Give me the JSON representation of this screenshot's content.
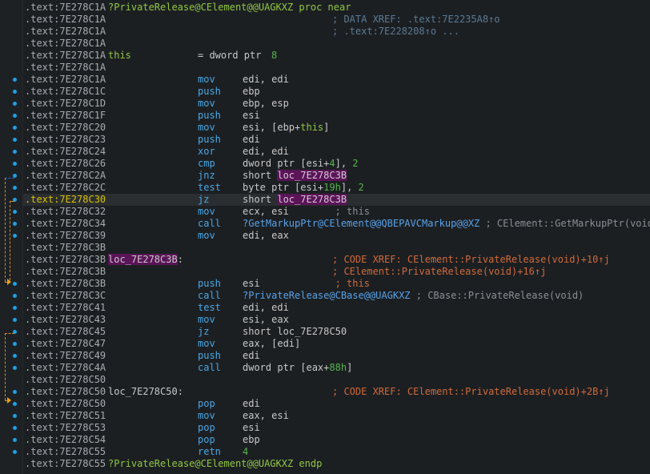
{
  "colors": {
    "background": "#1c1f22",
    "address": "#a8acb0",
    "highlight_address": "#d9c300",
    "mnemonic": "#4aa7e6",
    "comment": "#5a7a94",
    "label_bg": "#5a1457",
    "jump_arrow": "#d98b1d"
  },
  "rows": [
    {
      "addr": ".text:7E278C1A",
      "parts": [
        {
          "col": "label",
          "cls": "kw",
          "text": "?PrivateRelease@CElement@@UAGKXZ proc near"
        }
      ]
    },
    {
      "addr": ".text:7E278C1A",
      "parts": [
        {
          "col": "cmt",
          "text": "; DATA XREF: .text:7E2235A8↑o"
        }
      ]
    },
    {
      "addr": ".text:7E278C1A",
      "parts": [
        {
          "col": "cmt",
          "text": "; .text:7E228208↑o ..."
        }
      ]
    },
    {
      "addr": ".text:7E278C1A",
      "parts": []
    },
    {
      "addr": ".text:7E278C1A",
      "parts": [
        {
          "col": "label",
          "cls": "kw",
          "text": "this"
        },
        {
          "col": "mnem",
          "cls": "p",
          "text": "= dword ptr  "
        },
        {
          "col": "ops",
          "cls": "num",
          "text": "8",
          "offset": 92
        }
      ]
    },
    {
      "addr": ".text:7E278C1A",
      "parts": []
    },
    {
      "addr": ".text:7E278C1A",
      "parts": [
        {
          "col": "mnem",
          "text": "mov"
        },
        {
          "col": "ops",
          "text": "edi, edi"
        }
      ]
    },
    {
      "addr": ".text:7E278C1C",
      "parts": [
        {
          "col": "mnem",
          "text": "push"
        },
        {
          "col": "ops",
          "text": "ebp"
        }
      ]
    },
    {
      "addr": ".text:7E278C1D",
      "parts": [
        {
          "col": "mnem",
          "text": "mov"
        },
        {
          "col": "ops",
          "text": "ebp, esp"
        }
      ]
    },
    {
      "addr": ".text:7E278C1F",
      "parts": [
        {
          "col": "mnem",
          "text": "push"
        },
        {
          "col": "ops",
          "text": "esi"
        }
      ]
    },
    {
      "addr": ".text:7E278C20",
      "parts": [
        {
          "col": "mnem",
          "text": "mov"
        },
        {
          "col": "ops",
          "html": "esi, [ebp+<span class='kw'>this</span>]"
        }
      ]
    },
    {
      "addr": ".text:7E278C23",
      "parts": [
        {
          "col": "mnem",
          "text": "push"
        },
        {
          "col": "ops",
          "text": "edi"
        }
      ]
    },
    {
      "addr": ".text:7E278C24",
      "parts": [
        {
          "col": "mnem",
          "text": "xor"
        },
        {
          "col": "ops",
          "text": "edi, edi"
        }
      ]
    },
    {
      "addr": ".text:7E278C26",
      "parts": [
        {
          "col": "mnem",
          "text": "cmp"
        },
        {
          "col": "ops",
          "html": "dword ptr [esi+<span class='num'>4</span>], <span class='num'>2</span>"
        }
      ]
    },
    {
      "addr": ".text:7E278C2A",
      "parts": [
        {
          "col": "mnem",
          "text": "jnz"
        },
        {
          "col": "ops",
          "html": "short <span class='locbg'>loc_7E278C3B</span>"
        }
      ]
    },
    {
      "addr": ".text:7E278C2C",
      "parts": [
        {
          "col": "mnem",
          "text": "test"
        },
        {
          "col": "ops",
          "html": "byte ptr [esi+<span class='num'>19h</span>], <span class='num'>2</span>"
        }
      ]
    },
    {
      "addr": ".text:7E278C30",
      "hl": true,
      "parts": [
        {
          "col": "mnem",
          "text": "jz"
        },
        {
          "col": "ops",
          "html": "short <span class='locbg'>loc_7E278C3B</span>"
        }
      ]
    },
    {
      "addr": ".text:7E278C32",
      "parts": [
        {
          "col": "mnem",
          "text": "mov"
        },
        {
          "col": "ops",
          "html": "ecx, esi        <span class='cmtgray'>; this</span>"
        }
      ]
    },
    {
      "addr": ".text:7E278C34",
      "parts": [
        {
          "col": "mnem",
          "text": "call"
        },
        {
          "col": "ops",
          "html": "<span class='sym'>?GetMarkupPtr@CElement@@QBEPAVCMarkup@@XZ</span> <span class='cmtgray'>; CElement::GetMarkupPtr(void)</span>"
        }
      ]
    },
    {
      "addr": ".text:7E278C39",
      "parts": [
        {
          "col": "mnem",
          "text": "mov"
        },
        {
          "col": "ops",
          "text": "edi, eax"
        }
      ]
    },
    {
      "addr": ".text:7E278C3B",
      "parts": []
    },
    {
      "addr": ".text:7E278C3B",
      "parts": [
        {
          "col": "label",
          "cls": "lbl",
          "html": "<span class='nm'>loc_7E278C3B</span>:"
        },
        {
          "col": "cmt",
          "html": "<span class='xrefcmt'>; CODE XREF: CElement::PrivateRelease(void)+10↑j</span>"
        }
      ]
    },
    {
      "addr": ".text:7E278C3B",
      "parts": [
        {
          "col": "cmt",
          "html": "<span class='xrefcmt'>; CElement::PrivateRelease(void)+16↑j</span>"
        }
      ]
    },
    {
      "addr": ".text:7E278C3B",
      "parts": [
        {
          "col": "mnem",
          "text": "push"
        },
        {
          "col": "ops",
          "html": "esi             <span class='xrefcmt'>; this</span>"
        }
      ]
    },
    {
      "addr": ".text:7E278C3C",
      "parts": [
        {
          "col": "mnem",
          "text": "call"
        },
        {
          "col": "ops",
          "html": "<span class='sym'>?PrivateRelease@CBase@@UAGKXZ</span> <span class='cmtgray'>; CBase::PrivateRelease(void)</span>"
        }
      ]
    },
    {
      "addr": ".text:7E278C41",
      "parts": [
        {
          "col": "mnem",
          "text": "test"
        },
        {
          "col": "ops",
          "text": "edi, edi"
        }
      ]
    },
    {
      "addr": ".text:7E278C43",
      "parts": [
        {
          "col": "mnem",
          "text": "mov"
        },
        {
          "col": "ops",
          "text": "esi, eax"
        }
      ]
    },
    {
      "addr": ".text:7E278C45",
      "parts": [
        {
          "col": "mnem",
          "text": "jz"
        },
        {
          "col": "ops",
          "text": "short loc_7E278C50"
        }
      ]
    },
    {
      "addr": ".text:7E278C47",
      "parts": [
        {
          "col": "mnem",
          "text": "mov"
        },
        {
          "col": "ops",
          "text": "eax, [edi]"
        }
      ]
    },
    {
      "addr": ".text:7E278C49",
      "parts": [
        {
          "col": "mnem",
          "text": "push"
        },
        {
          "col": "ops",
          "text": "edi"
        }
      ]
    },
    {
      "addr": ".text:7E278C4A",
      "parts": [
        {
          "col": "mnem",
          "text": "call"
        },
        {
          "col": "ops",
          "html": "dword ptr [eax+<span class='num'>88h</span>]"
        }
      ]
    },
    {
      "addr": ".text:7E278C50",
      "parts": []
    },
    {
      "addr": ".text:7E278C50",
      "parts": [
        {
          "col": "label",
          "cls": "lbl2",
          "text": "loc_7E278C50:"
        },
        {
          "col": "cmt",
          "html": "<span class='xrefcmt'>; CODE XREF: CElement::PrivateRelease(void)+2B↑j</span>"
        }
      ]
    },
    {
      "addr": ".text:7E278C50",
      "parts": [
        {
          "col": "mnem",
          "text": "pop"
        },
        {
          "col": "ops",
          "text": "edi"
        }
      ]
    },
    {
      "addr": ".text:7E278C51",
      "parts": [
        {
          "col": "mnem",
          "text": "mov"
        },
        {
          "col": "ops",
          "text": "eax, esi"
        }
      ]
    },
    {
      "addr": ".text:7E278C53",
      "parts": [
        {
          "col": "mnem",
          "text": "pop"
        },
        {
          "col": "ops",
          "text": "esi"
        }
      ]
    },
    {
      "addr": ".text:7E278C54",
      "parts": [
        {
          "col": "mnem",
          "text": "pop"
        },
        {
          "col": "ops",
          "text": "ebp"
        }
      ]
    },
    {
      "addr": ".text:7E278C55",
      "parts": [
        {
          "col": "mnem",
          "text": "retn"
        },
        {
          "col": "ops",
          "cls": "num",
          "text": "4"
        }
      ]
    },
    {
      "addr": ".text:7E278C55",
      "parts": [
        {
          "col": "label",
          "cls": "kw",
          "text": "?PrivateRelease@CElement@@UAGKXZ endp"
        }
      ]
    }
  ],
  "breakpoint_dot_rows": [
    6,
    7,
    8,
    9,
    10,
    11,
    12,
    13,
    14,
    15,
    16,
    17,
    18,
    19,
    23,
    24,
    25,
    26,
    27,
    28,
    29,
    30,
    32,
    33,
    34,
    35,
    36,
    37
  ]
}
